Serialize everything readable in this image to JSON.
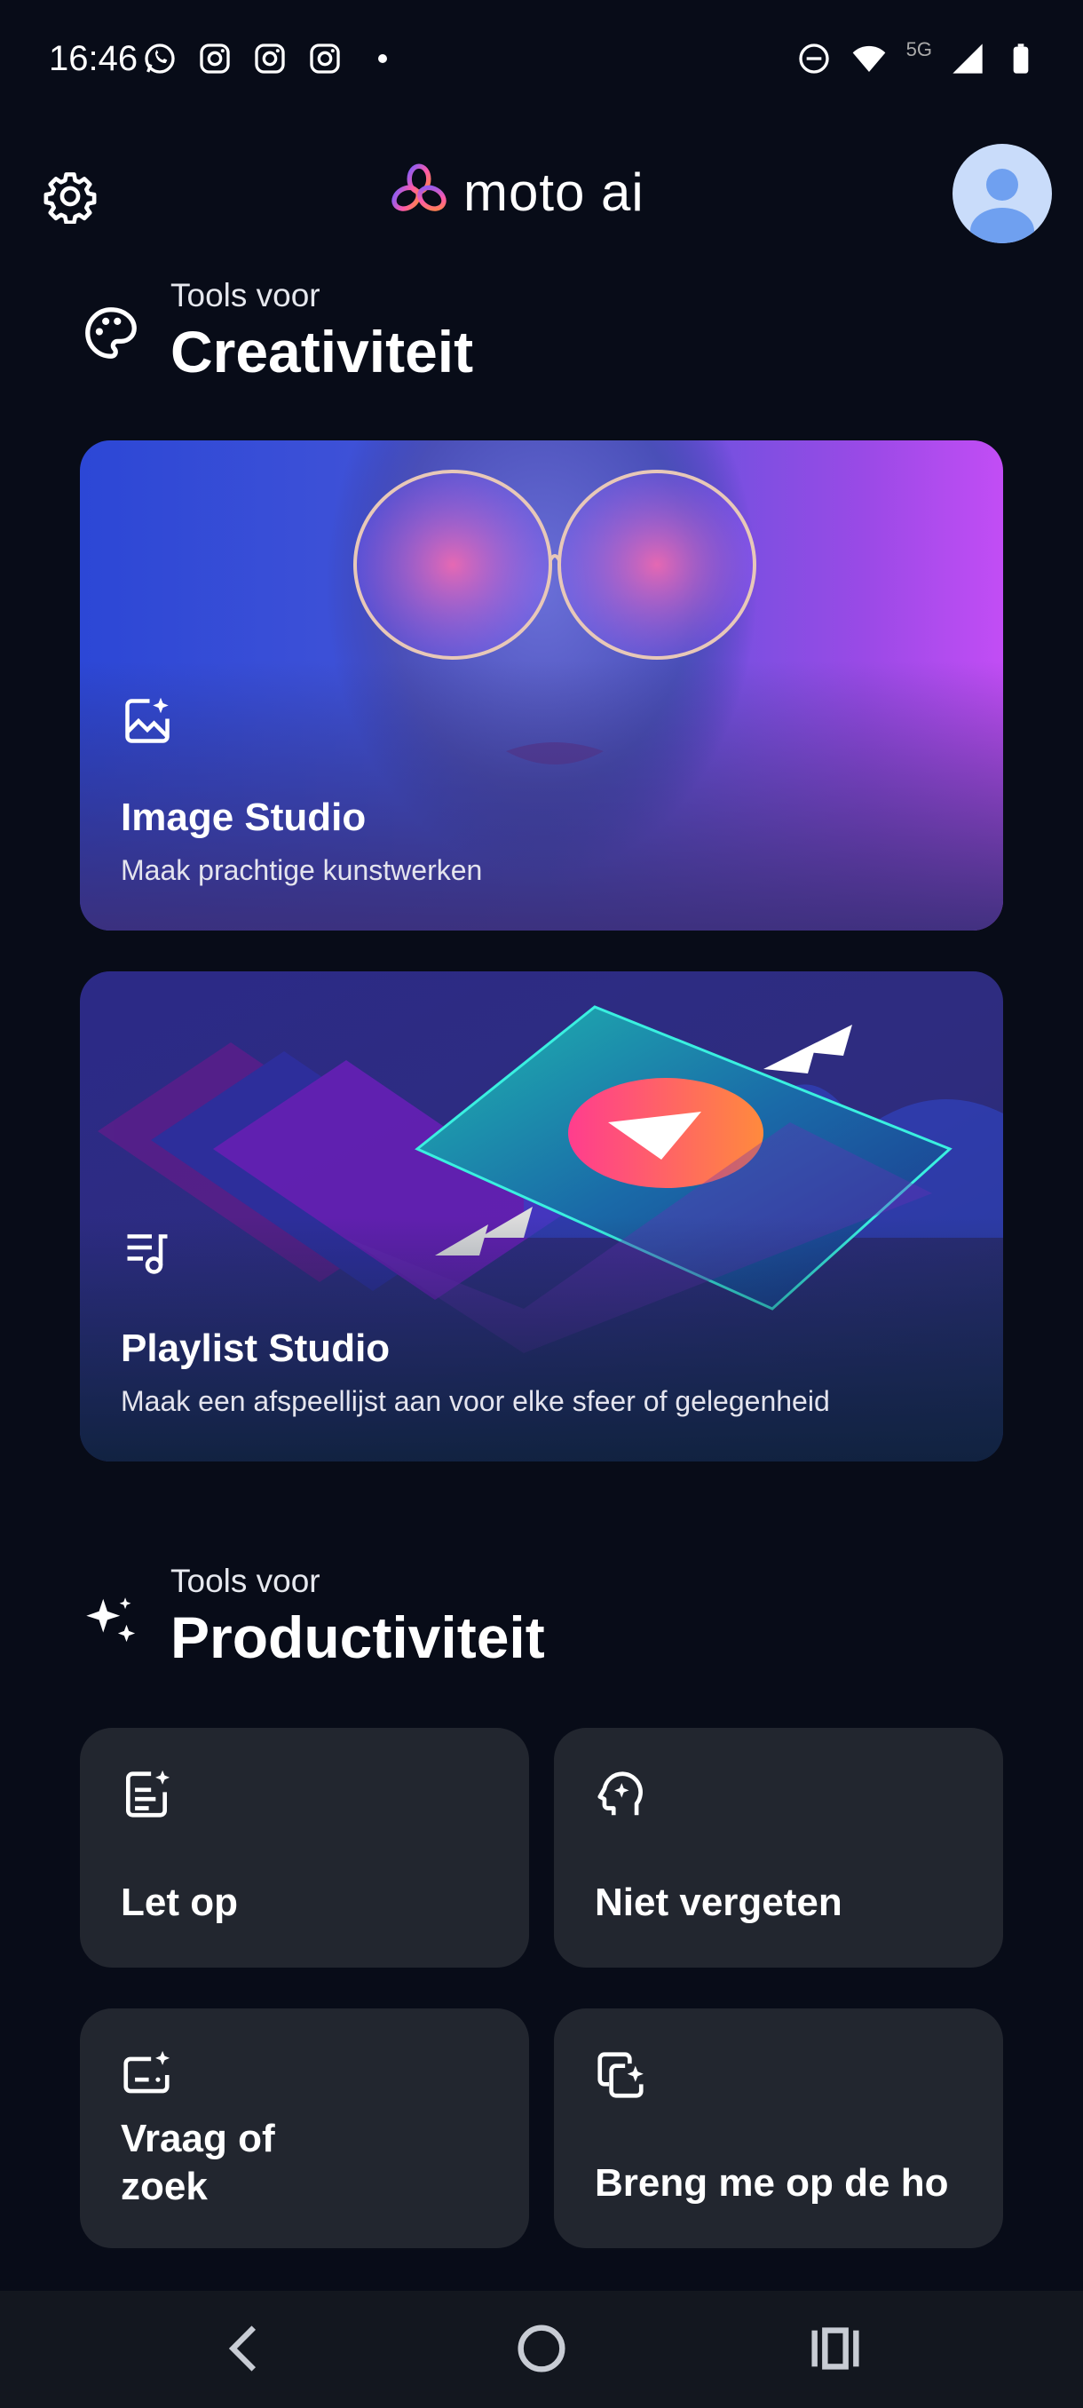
{
  "status_bar": {
    "time": "16:46",
    "left_icons": [
      "whatsapp-icon",
      "instagram-icon",
      "instagram-icon",
      "instagram-icon",
      "dot-icon"
    ],
    "network_label": "5G",
    "right_icons": [
      "dnd-icon",
      "wifi-icon",
      "signal-icon",
      "battery-icon"
    ]
  },
  "header": {
    "app_name": "moto ai",
    "settings_icon": "gear-icon",
    "avatar_icon": "person-icon"
  },
  "sections": {
    "creativity": {
      "subtitle": "Tools voor",
      "title": "Creativiteit",
      "icon": "palette-icon",
      "cards": [
        {
          "title": "Image Studio",
          "description": "Maak prachtige kunstwerken",
          "icon": "image-sparkle-icon"
        },
        {
          "title": "Playlist Studio",
          "description": "Maak een afspeellijst aan voor elke sfeer of gelegenheid",
          "icon": "playlist-icon"
        }
      ]
    },
    "productivity": {
      "subtitle": "Tools voor",
      "title": "Productiviteit",
      "icon": "sparkles-icon",
      "tiles": [
        {
          "label": "Let op",
          "icon": "note-sparkle-icon"
        },
        {
          "label": "Niet vergeten",
          "icon": "head-sparkle-icon"
        },
        {
          "label": "Vraag of\nzoek",
          "icon": "ask-sparkle-icon"
        },
        {
          "label": "Breng me op de ho",
          "icon": "screens-sparkle-icon"
        }
      ]
    }
  },
  "nav_bar": {
    "buttons": [
      "back-icon",
      "home-icon",
      "recents-icon"
    ]
  },
  "colors": {
    "background": "#080c18",
    "tile": "#22262f",
    "logo_gradient": [
      "#7a5cff",
      "#ff5aa8",
      "#ff8a3d"
    ]
  }
}
